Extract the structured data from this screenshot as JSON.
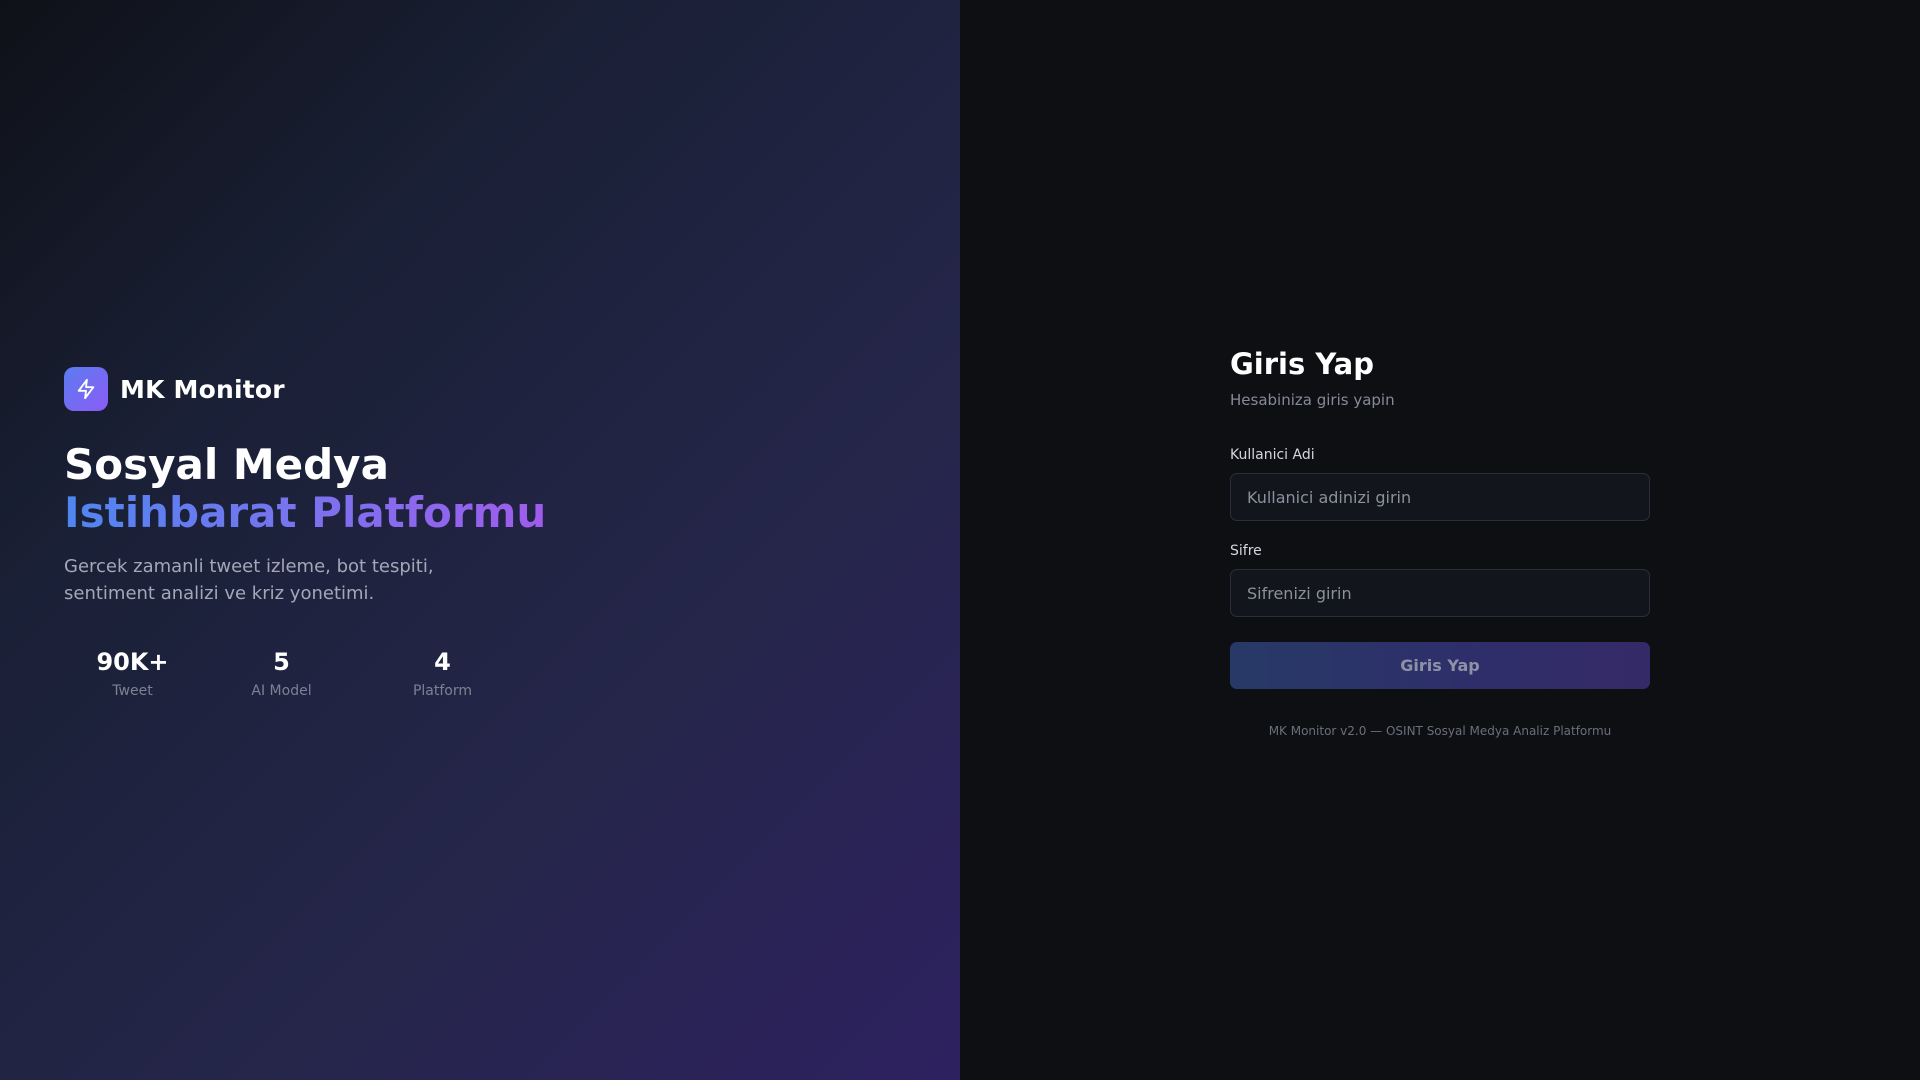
{
  "brand": {
    "name": "MK Monitor",
    "icon": "lightning-bolt-icon"
  },
  "hero": {
    "headline_line1": "Sosyal Medya",
    "headline_line2": "Istihbarat Platformu",
    "description": "Gercek zamanli tweet izleme, bot tespiti, sentiment analizi ve kriz yonetimi.",
    "stats": [
      {
        "value": "90K+",
        "label": "Tweet"
      },
      {
        "value": "5",
        "label": "AI Model"
      },
      {
        "value": "4",
        "label": "Platform"
      }
    ]
  },
  "login": {
    "title": "Giris Yap",
    "subtitle": "Hesabiniza giris yapin",
    "username": {
      "label": "Kullanici Adi",
      "placeholder": "Kullanici adinizi girin",
      "value": ""
    },
    "password": {
      "label": "Sifre",
      "placeholder": "Sifrenizi girin",
      "value": ""
    },
    "submit_label": "Giris Yap",
    "footer": "MK Monitor v2.0 — OSINT Sosyal Medya Analiz Platformu"
  },
  "colors": {
    "accent_blue": "#5b7cf0",
    "accent_purple": "#8b5cf6",
    "page_background": "#0e0f13"
  }
}
